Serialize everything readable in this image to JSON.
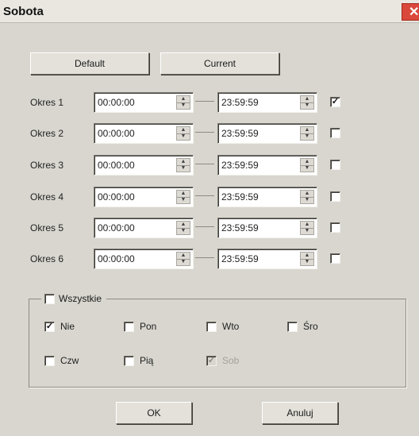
{
  "window": {
    "title": "Sobota",
    "close_glyph": "✕"
  },
  "buttons": {
    "default_label": "Default",
    "current_label": "Current",
    "ok_label": "OK",
    "cancel_label": "Anuluj"
  },
  "periods": [
    {
      "label": "Okres 1",
      "start": "00:00:00",
      "end": "23:59:59",
      "enabled": true
    },
    {
      "label": "Okres 2",
      "start": "00:00:00",
      "end": "23:59:59",
      "enabled": false
    },
    {
      "label": "Okres 3",
      "start": "00:00:00",
      "end": "23:59:59",
      "enabled": false
    },
    {
      "label": "Okres 4",
      "start": "00:00:00",
      "end": "23:59:59",
      "enabled": false
    },
    {
      "label": "Okres 5",
      "start": "00:00:00",
      "end": "23:59:59",
      "enabled": false
    },
    {
      "label": "Okres 6",
      "start": "00:00:00",
      "end": "23:59:59",
      "enabled": false
    }
  ],
  "spinner": {
    "up_glyph": "▲",
    "down_glyph": "▼"
  },
  "copy_group": {
    "all_label": "Wszystkie",
    "all_checked": false,
    "days": [
      {
        "label": "Nie",
        "checked": true,
        "disabled": false
      },
      {
        "label": "Pon",
        "checked": false,
        "disabled": false
      },
      {
        "label": "Wto",
        "checked": false,
        "disabled": false
      },
      {
        "label": "Śro",
        "checked": false,
        "disabled": false
      },
      {
        "label": "Czw",
        "checked": false,
        "disabled": false
      },
      {
        "label": "Pią",
        "checked": false,
        "disabled": false
      },
      {
        "label": "Sob",
        "checked": true,
        "disabled": true
      }
    ]
  },
  "check_glyph": "✓",
  "colors": {
    "dialog_bg": "#d8d6cf",
    "close_red": "#d9483b"
  }
}
